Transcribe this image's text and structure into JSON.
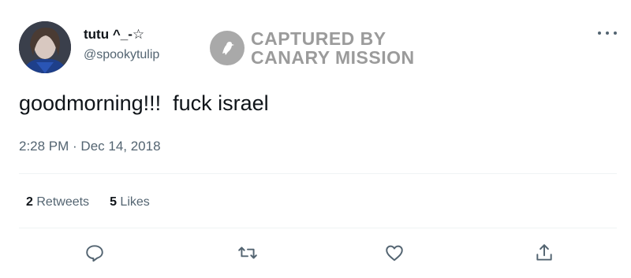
{
  "tweet": {
    "display_name": "tutu ^_-☆",
    "handle": "@spookytulip",
    "text": "goodmorning!!!  fuck israel",
    "timestamp": "2:28 PM · Dec 14, 2018",
    "stats": {
      "retweets_count": "2",
      "retweets_label": "Retweets",
      "likes_count": "5",
      "likes_label": "Likes"
    }
  },
  "watermark": {
    "line1": "CAPTURED BY",
    "line2": "CANARY MISSION"
  },
  "icons": {
    "more": "more-options-icon",
    "reply": "reply-icon",
    "retweet": "retweet-icon",
    "like": "like-icon",
    "share": "share-icon"
  },
  "colors": {
    "text": "#0f1419",
    "secondary": "#536471",
    "divider": "#eff3f4",
    "watermark": "#9b9b9b"
  }
}
